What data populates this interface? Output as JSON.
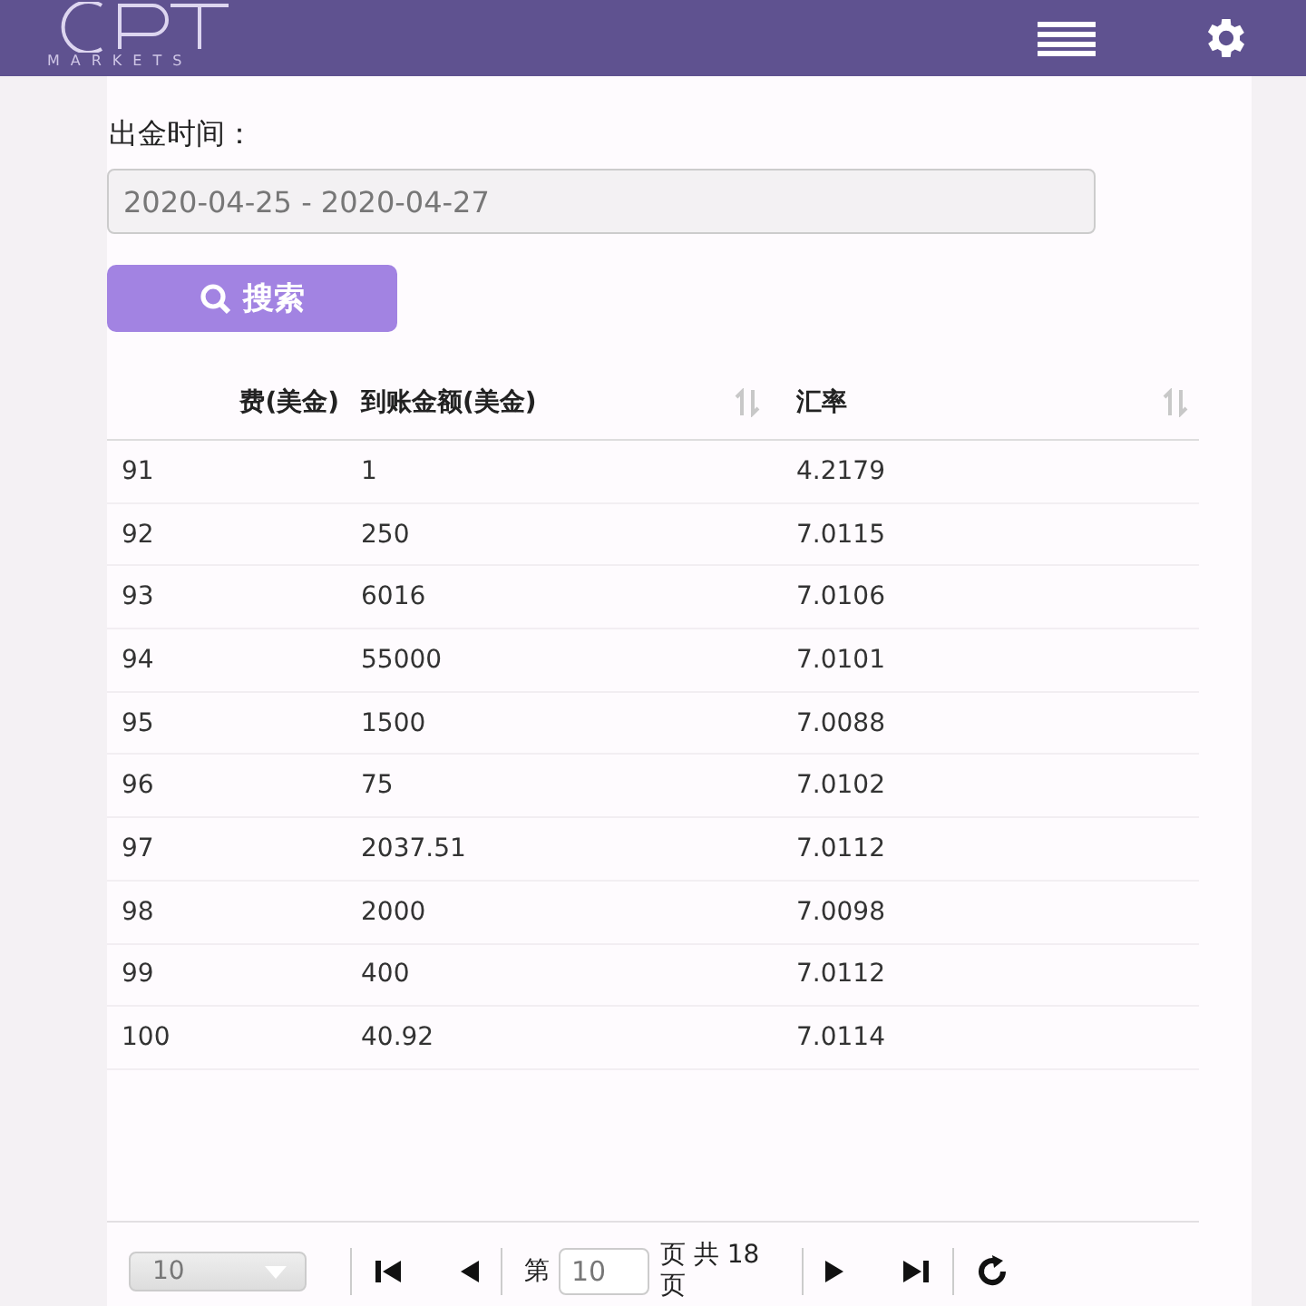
{
  "header": {
    "logo_text": "MARKETS"
  },
  "filter": {
    "label": "出金时间：",
    "date_range": "2020-04-25 - 2020-04-27",
    "search_button": "搜索"
  },
  "table": {
    "columns": [
      {
        "label": "费(美金)",
        "sortable": false
      },
      {
        "label": "到账金额(美金)",
        "sortable": true
      },
      {
        "label": "汇率",
        "sortable": true
      }
    ],
    "rows": [
      [
        "91",
        "1",
        "4.2179"
      ],
      [
        "92",
        "250",
        "7.0115"
      ],
      [
        "93",
        "6016",
        "7.0106"
      ],
      [
        "94",
        "55000",
        "7.0101"
      ],
      [
        "95",
        "1500",
        "7.0088"
      ],
      [
        "96",
        "75",
        "7.0102"
      ],
      [
        "97",
        "2037.51",
        "7.0112"
      ],
      [
        "98",
        "2000",
        "7.0098"
      ],
      [
        "99",
        "400",
        "7.0112"
      ],
      [
        "100",
        "40.92",
        "7.0114"
      ]
    ]
  },
  "pagination": {
    "page_size": "10",
    "page_prefix": "第",
    "page": "10",
    "page_suffix": "页 共 18 页"
  }
}
